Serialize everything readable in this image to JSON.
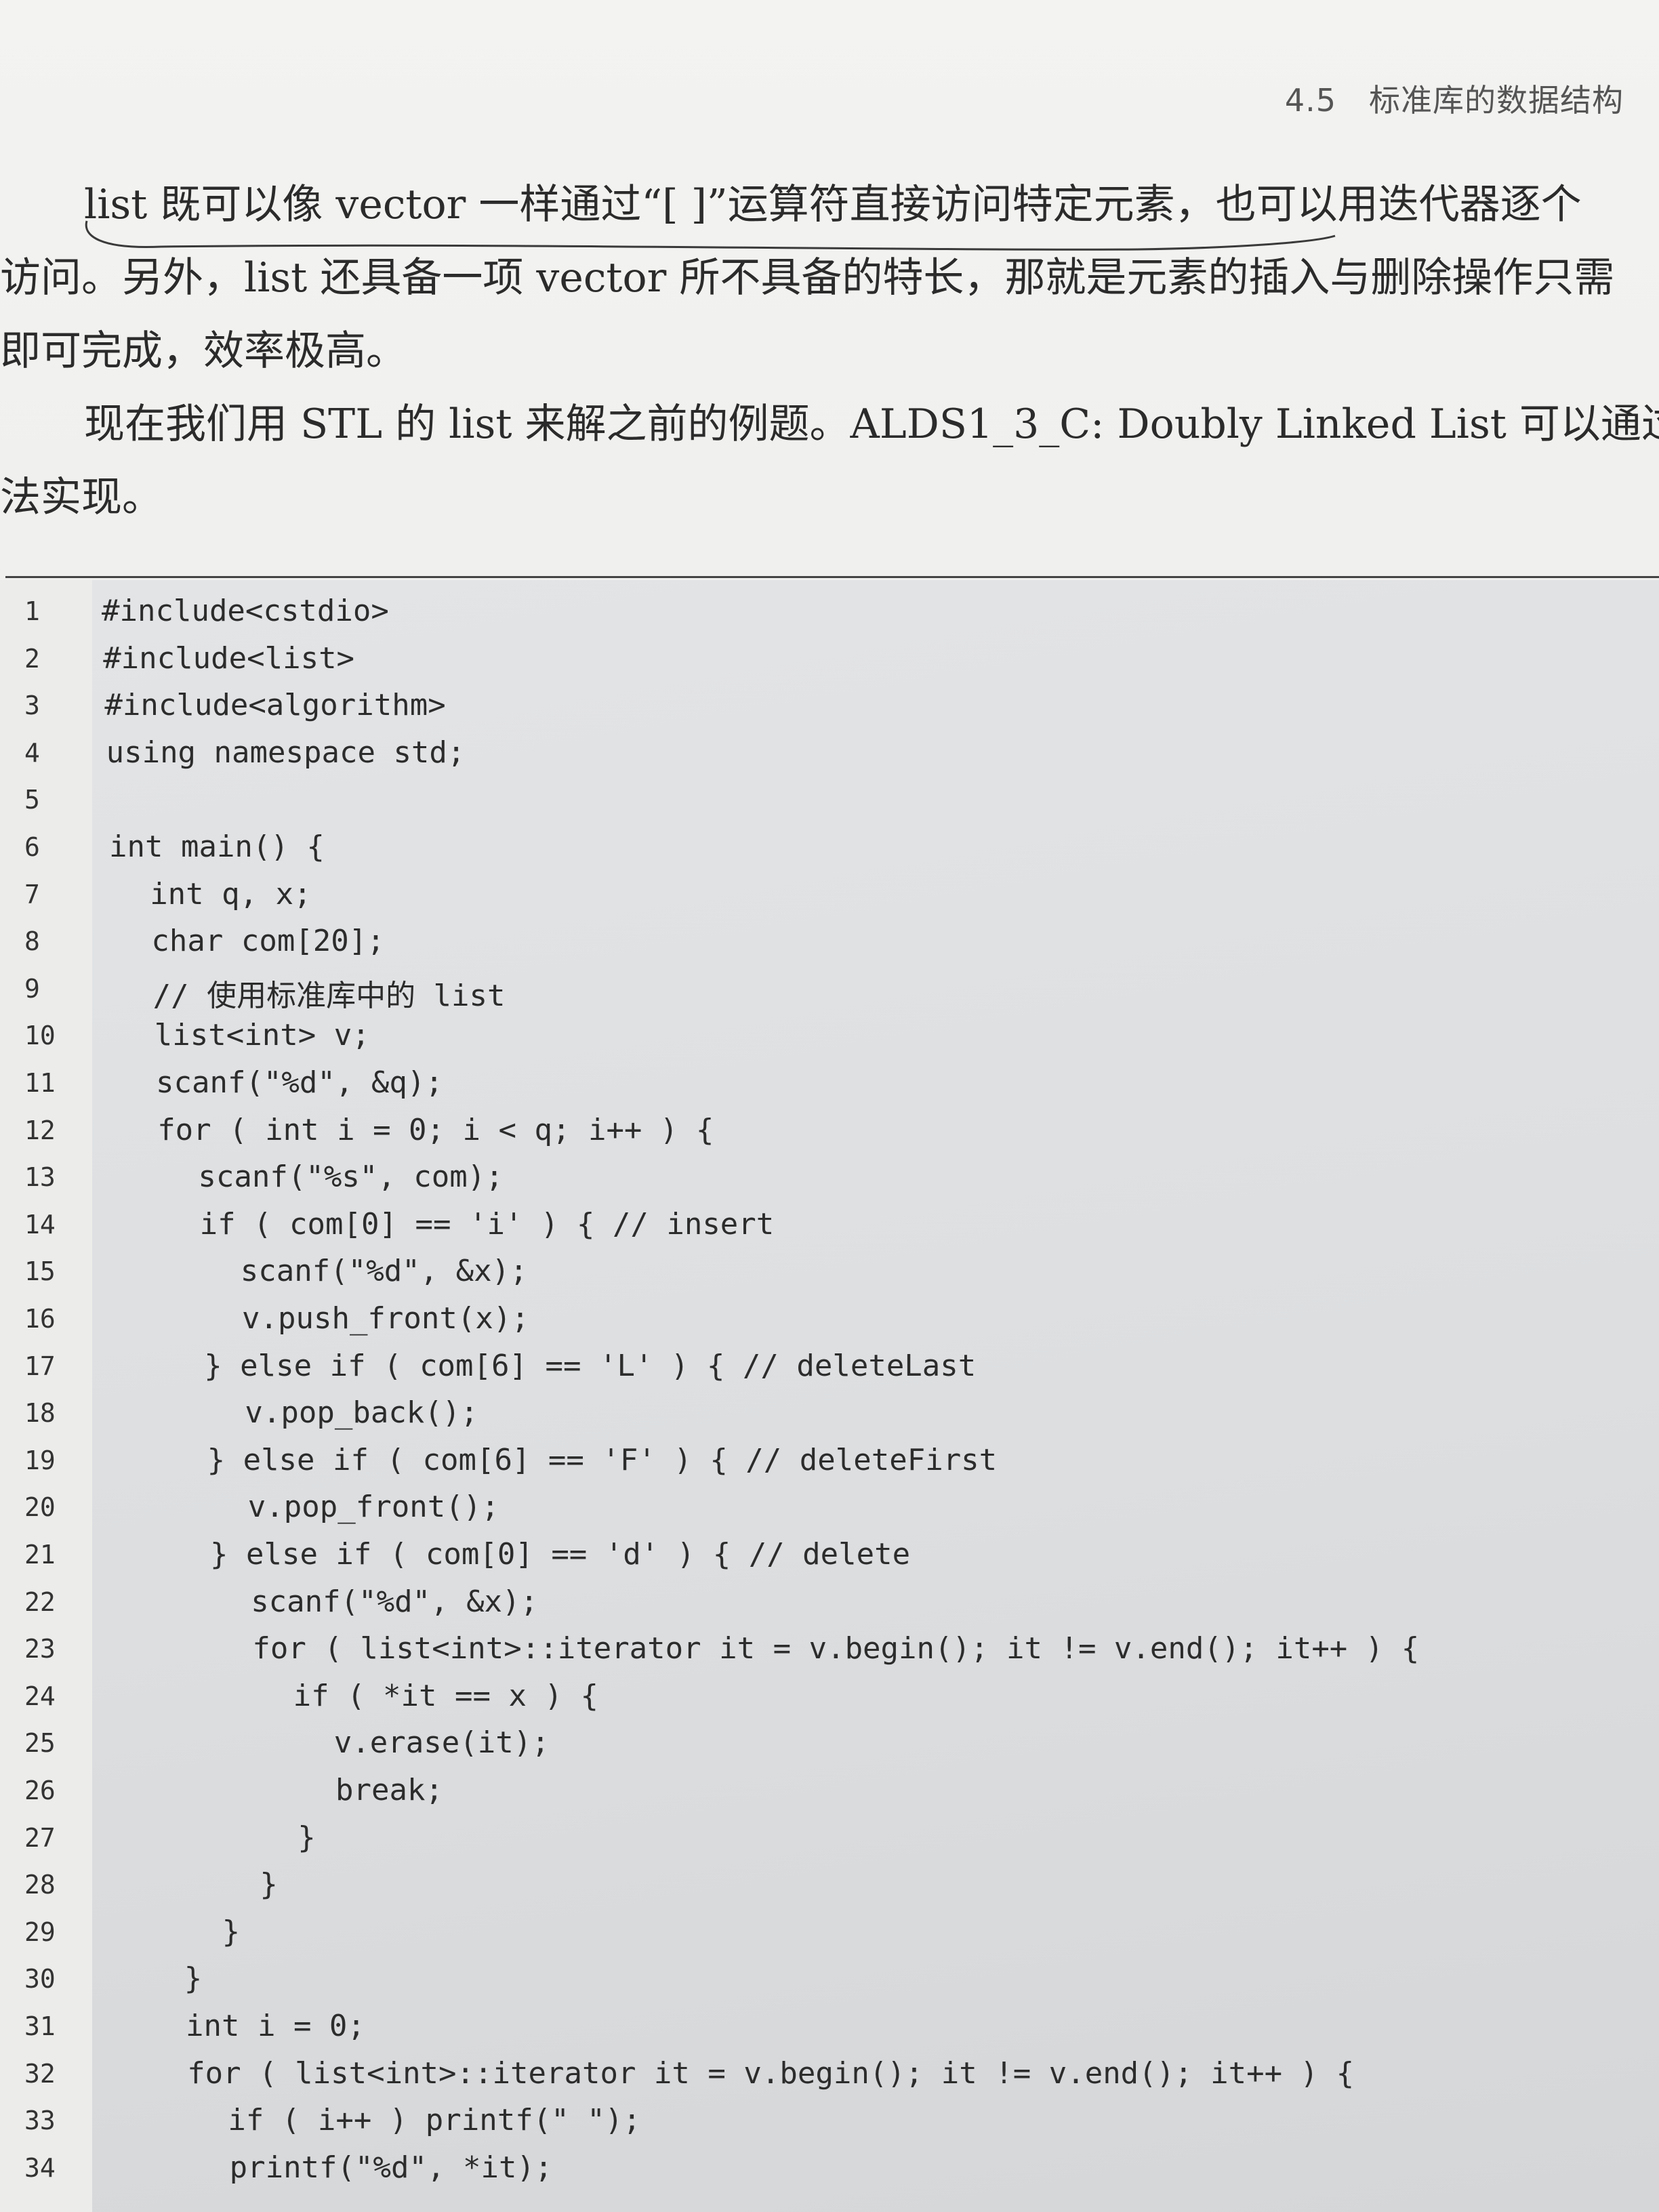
{
  "header": {
    "section_number": "4.5",
    "section_title": "标准库的数据结构"
  },
  "paragraphs": [
    [
      "list 既可以像 vector 一样通过“[ ]”运算符直接访问特定元素，也可以用迭代器逐个",
      "访问。另外，list 还具备一项 vector 所不具备的特长，那就是元素的插入与删除操作只需",
      "即可完成，效率极高。"
    ],
    [
      "现在我们用 STL 的 list 来解之前的例题。ALDS1_3_C: Doubly Linked List 可以通过下",
      "法实现。"
    ]
  ],
  "code": {
    "lines": [
      {
        "n": "1",
        "indent": 0,
        "text": "#include<cstdio>"
      },
      {
        "n": "2",
        "indent": 0,
        "text": "#include<list>"
      },
      {
        "n": "3",
        "indent": 0,
        "text": "#include<algorithm>"
      },
      {
        "n": "4",
        "indent": 0,
        "text": "using namespace std;"
      },
      {
        "n": "5",
        "indent": 0,
        "text": ""
      },
      {
        "n": "6",
        "indent": 0,
        "text": "int main() {"
      },
      {
        "n": "7",
        "indent": 1,
        "text": "int q, x;"
      },
      {
        "n": "8",
        "indent": 1,
        "text": "char com[20];"
      },
      {
        "n": "9",
        "indent": 1,
        "text": "// 使用标准库中的 list"
      },
      {
        "n": "10",
        "indent": 1,
        "text": "list<int> v;"
      },
      {
        "n": "11",
        "indent": 1,
        "text": "scanf(\"%d\", &q);"
      },
      {
        "n": "12",
        "indent": 1,
        "text": "for ( int i = 0; i < q; i++ ) {"
      },
      {
        "n": "13",
        "indent": 2,
        "text": "scanf(\"%s\", com);"
      },
      {
        "n": "14",
        "indent": 2,
        "text": "if ( com[0] == 'i' ) { // insert"
      },
      {
        "n": "15",
        "indent": 3,
        "text": "scanf(\"%d\", &x);"
      },
      {
        "n": "16",
        "indent": 3,
        "text": "v.push_front(x);"
      },
      {
        "n": "17",
        "indent": 2,
        "text": "} else if ( com[6] == 'L' ) { // deleteLast"
      },
      {
        "n": "18",
        "indent": 3,
        "text": "v.pop_back();"
      },
      {
        "n": "19",
        "indent": 2,
        "text": "} else if ( com[6] == 'F' ) { // deleteFirst"
      },
      {
        "n": "20",
        "indent": 3,
        "text": "v.pop_front();"
      },
      {
        "n": "21",
        "indent": 2,
        "text": "} else if ( com[0] == 'd' ) { // delete"
      },
      {
        "n": "22",
        "indent": 3,
        "text": "scanf(\"%d\", &x);"
      },
      {
        "n": "23",
        "indent": 3,
        "text": "for ( list<int>::iterator it = v.begin(); it != v.end(); it++ ) {"
      },
      {
        "n": "24",
        "indent": 4,
        "text": "if ( *it == x ) {"
      },
      {
        "n": "25",
        "indent": 5,
        "text": "v.erase(it);"
      },
      {
        "n": "26",
        "indent": 5,
        "text": "break;"
      },
      {
        "n": "27",
        "indent": 4,
        "text": "}"
      },
      {
        "n": "28",
        "indent": 3,
        "text": "}"
      },
      {
        "n": "29",
        "indent": 2,
        "text": "}"
      },
      {
        "n": "30",
        "indent": 1,
        "text": "}"
      },
      {
        "n": "31",
        "indent": 1,
        "text": "int i = 0;"
      },
      {
        "n": "32",
        "indent": 1,
        "text": "for ( list<int>::iterator it = v.begin(); it != v.end(); it++ ) {"
      },
      {
        "n": "33",
        "indent": 2,
        "text": "if ( i++ ) printf(\" \");"
      },
      {
        "n": "34",
        "indent": 2,
        "text": "printf(\"%d\", *it);"
      }
    ]
  }
}
